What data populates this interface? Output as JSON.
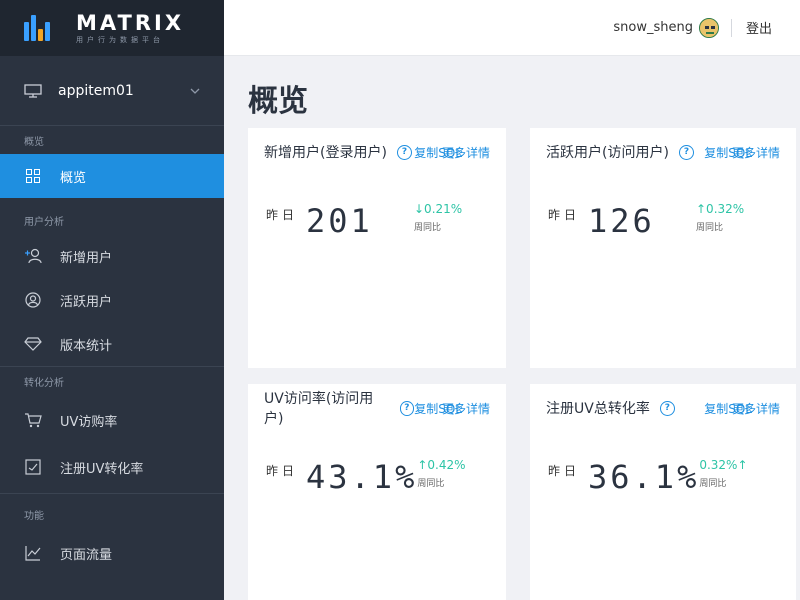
{
  "logo": {
    "title": "MATRIX",
    "subtitle": "用户行为数据平台"
  },
  "app_selector": {
    "value": "appitem01"
  },
  "sidebar": {
    "groups": [
      {
        "label": "概览",
        "items": [
          {
            "label": "概览",
            "icon": "grid-icon",
            "active": true
          }
        ]
      },
      {
        "label": "用户分析",
        "items": [
          {
            "label": "新增用户",
            "icon": "add-user-icon"
          },
          {
            "label": "活跃用户",
            "icon": "user-circle-icon"
          },
          {
            "label": "版本统计",
            "icon": "diamond-icon"
          }
        ]
      },
      {
        "label": "转化分析",
        "items": [
          {
            "label": "UV访购率",
            "icon": "cart-icon"
          },
          {
            "label": "注册UV转化率",
            "icon": "checkbox-icon"
          }
        ]
      },
      {
        "label": "功能",
        "items": [
          {
            "label": "页面流量",
            "icon": "line-chart-icon"
          }
        ]
      }
    ]
  },
  "header": {
    "username": "snow_sheng",
    "logout": "登出"
  },
  "page": {
    "title": "概览"
  },
  "cards": [
    {
      "title": "新增用户(登录用户)",
      "link_copy": "复制SQL",
      "link_more": "更多详情",
      "yesterday_label": "昨日",
      "value": "201",
      "change": "↓0.21%",
      "compare_label": "周同比"
    },
    {
      "title": "活跃用户(访问用户)",
      "link_copy": "复制SQL",
      "link_more": "更多详情",
      "yesterday_label": "昨日",
      "value": "126",
      "change": "↑0.32%",
      "compare_label": "周同比"
    },
    {
      "title": "UV访问率(访问用户)",
      "link_copy": "复制SQL",
      "link_more": "更多详情",
      "yesterday_label": "昨日",
      "value": "43.1%",
      "change": "↑0.42%",
      "compare_label": "周同比"
    },
    {
      "title": "注册UV总转化率",
      "link_copy": "复制SQL",
      "link_more": "更多详情",
      "yesterday_label": "昨日",
      "value": "36.1%",
      "change": "0.32%↑",
      "compare_label": "周同比"
    }
  ],
  "colors": {
    "sidebar_bg": "#2b3340",
    "accent": "#1f8fe0",
    "positive": "#2ec4a6"
  }
}
